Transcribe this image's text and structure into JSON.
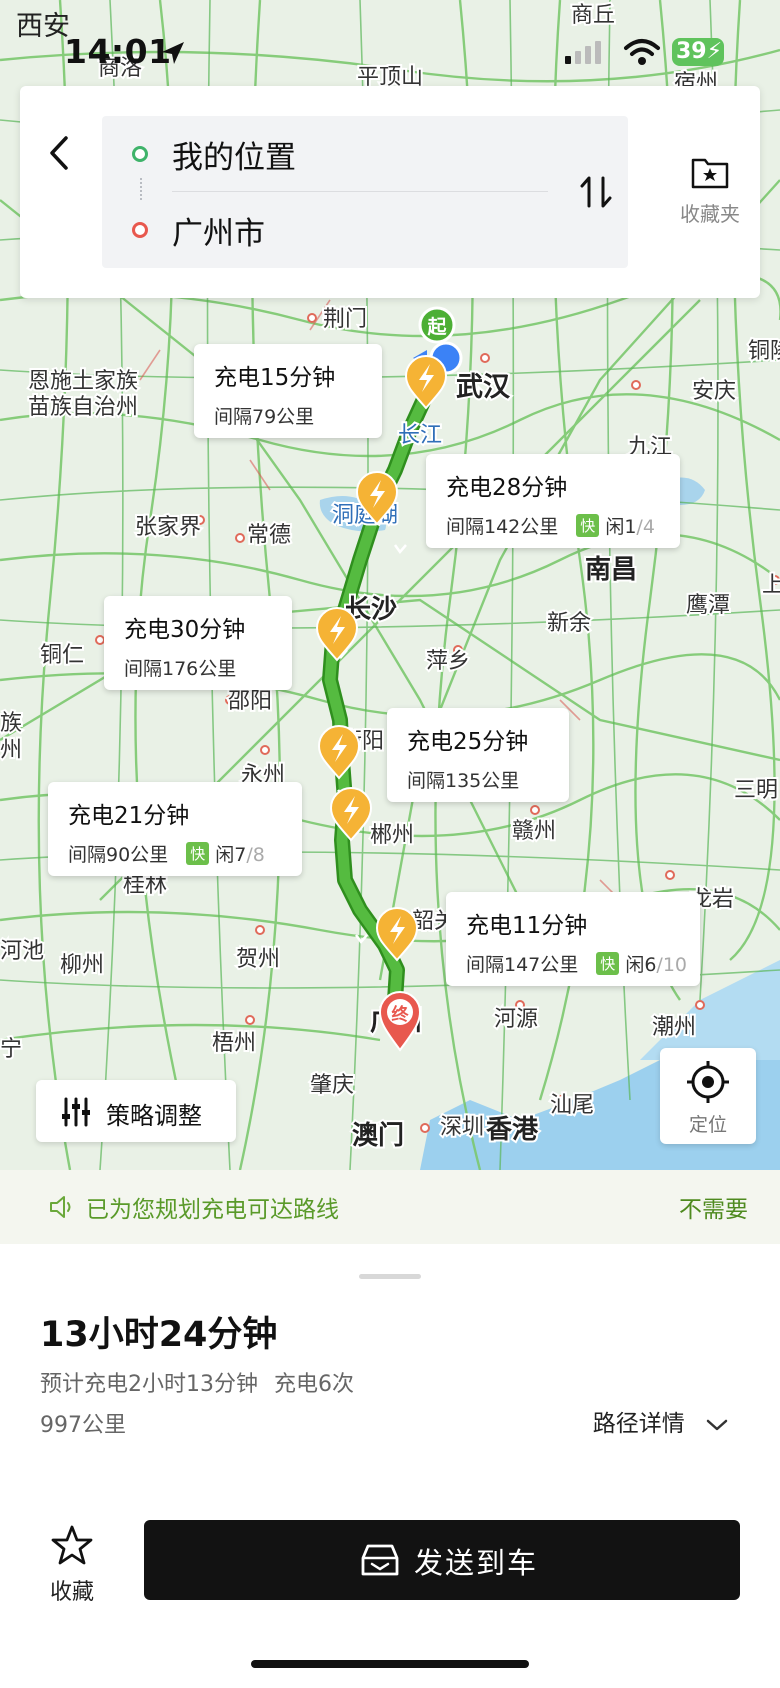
{
  "status_bar": {
    "city": "西安",
    "time": "14:01",
    "battery": "39"
  },
  "search": {
    "origin": "我的位置",
    "destination": "广州市",
    "favorites_label": "收藏夹"
  },
  "map": {
    "cities": [
      "商丘",
      "商洛",
      "平顶山",
      "宿州",
      "荆门",
      "铜陵",
      "恩施土家族",
      "苗族自治州",
      "武汉",
      "长江",
      "安庆",
      "九江",
      "洞庭湖",
      "张家界",
      "常德",
      "南昌",
      "长沙",
      "鹰潭",
      "新余",
      "上饶",
      "铜仁",
      "萍乡",
      "邵阳",
      "三明",
      "族",
      "州",
      "衡阳",
      "永州",
      "郴州",
      "赣州",
      "桂林",
      "韶关",
      "龙岩",
      "河池",
      "柳州",
      "贺州",
      "河源",
      "潮州",
      "宁",
      "梧州",
      "广州",
      "肇庆",
      "汕尾",
      "澳门",
      "深圳",
      "香港"
    ],
    "start_marker": "起",
    "end_marker": "终",
    "route_color": "#4caf35"
  },
  "charge_stops": [
    {
      "time": "充电15分钟",
      "interval": "间隔79公里"
    },
    {
      "time": "充电28分钟",
      "interval": "间隔142公里",
      "fast": "快",
      "free": "闲1",
      "total": "/4"
    },
    {
      "time": "充电30分钟",
      "interval": "间隔176公里"
    },
    {
      "time": "充电25分钟",
      "interval": "间隔135公里"
    },
    {
      "time": "充电21分钟",
      "interval": "间隔90公里",
      "fast": "快",
      "free": "闲7",
      "total": "/8"
    },
    {
      "time": "充电11分钟",
      "interval": "间隔147公里",
      "fast": "快",
      "free": "闲6",
      "total": "/10"
    }
  ],
  "controls": {
    "strategy_label": "策略调整",
    "locate_label": "定位"
  },
  "notice": {
    "text": "已为您规划充电可达路线",
    "dismiss": "不需要"
  },
  "summary": {
    "duration": "13小时24分钟",
    "charge_time": "预计充电2小时13分钟",
    "charge_count": "充电6次",
    "distance": "997公里",
    "detail_label": "路径详情"
  },
  "actions": {
    "favorite_label": "收藏",
    "send_label": "发送到车"
  }
}
